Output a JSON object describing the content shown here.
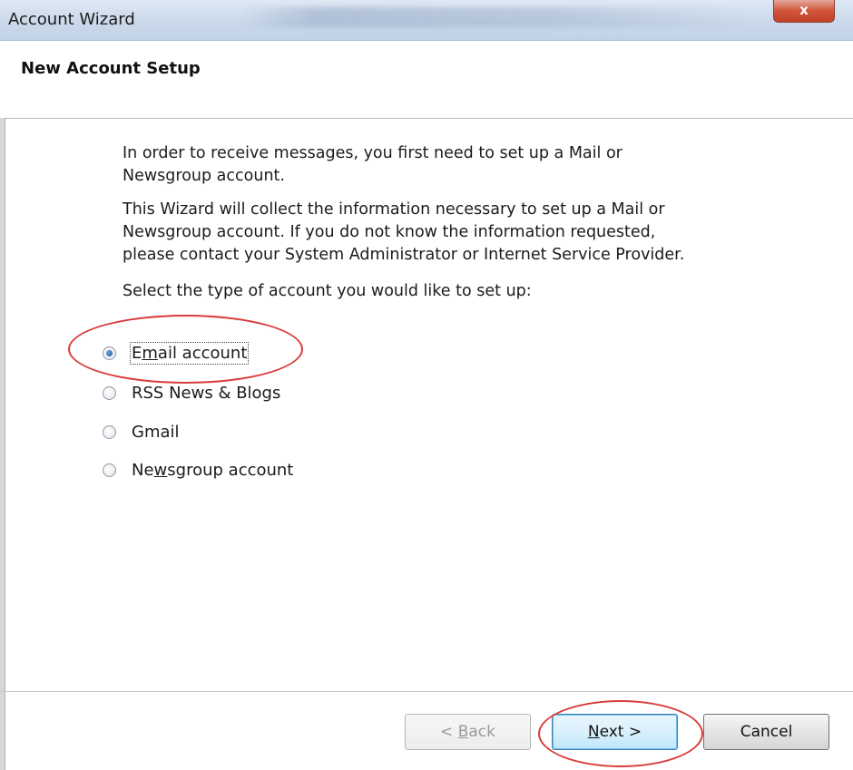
{
  "window": {
    "title": "Account Wizard",
    "close_label": "x"
  },
  "header": {
    "title": "New Account Setup"
  },
  "content": {
    "paragraph1_line1": "In order to receive messages, you first need to set up a Mail or",
    "paragraph1_line2": "Newsgroup account.",
    "paragraph2_line1": "This Wizard will collect the information necessary to set up a Mail or",
    "paragraph2_line2": "Newsgroup account. If you do not know the information requested,",
    "paragraph2_line3": "please contact your System Administrator or Internet Service Provider.",
    "prompt": "Select the type of account you would like to set up:"
  },
  "options": [
    {
      "label_pre": "E",
      "label_u": "m",
      "label_post": "ail account",
      "selected": true
    },
    {
      "label_pre": "RSS News & Blogs",
      "label_u": "",
      "label_post": "",
      "selected": false
    },
    {
      "label_pre": "Gmail",
      "label_u": "",
      "label_post": "",
      "selected": false
    },
    {
      "label_pre": "Ne",
      "label_u": "w",
      "label_post": "sgroup account",
      "selected": false
    }
  ],
  "buttons": {
    "back_pre": "< ",
    "back_u": "B",
    "back_post": "ack",
    "next_u": "N",
    "next_post": "ext >",
    "cancel": "Cancel"
  },
  "colors": {
    "annotation": "#d93a3a",
    "titlebar": "#cad9ea"
  }
}
